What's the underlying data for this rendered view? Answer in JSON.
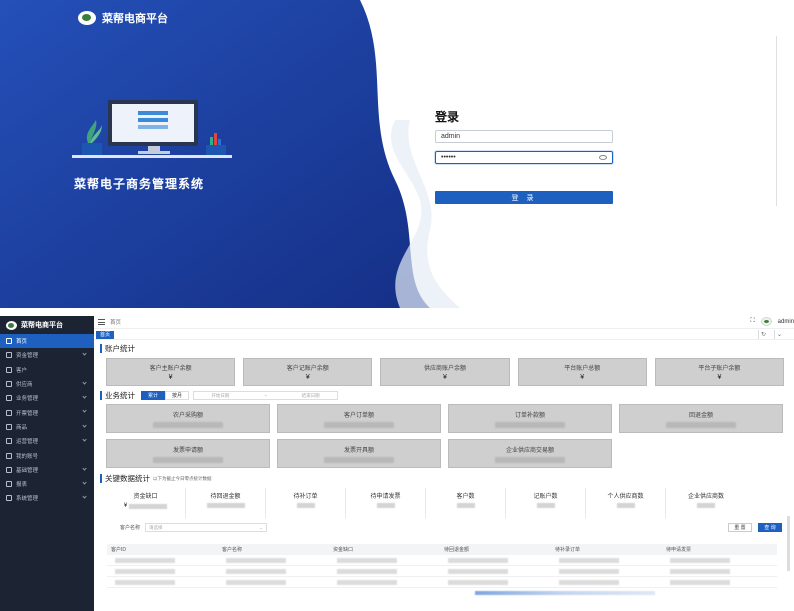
{
  "login": {
    "brand": "菜帮电商平台",
    "system_title": "菜帮电子商务管理系统",
    "form_title": "登录",
    "username_value": "admin",
    "password_value": "••••••",
    "submit_label": "登 录",
    "colors": {
      "primary": "#1e60c0",
      "bg_left": "#1a3f9f"
    }
  },
  "dashboard": {
    "sidebar": {
      "brand": "菜帮电商平台",
      "items": [
        {
          "label": "首页",
          "icon": "home-icon",
          "active": true,
          "chevron": false
        },
        {
          "label": "资金管理",
          "icon": "wallet-icon",
          "active": false,
          "chevron": true
        },
        {
          "label": "客户",
          "icon": "customer-icon",
          "active": false,
          "chevron": false
        },
        {
          "label": "供应商",
          "icon": "supplier-icon",
          "active": false,
          "chevron": true
        },
        {
          "label": "业务管理",
          "icon": "business-icon",
          "active": false,
          "chevron": true
        },
        {
          "label": "开票管理",
          "icon": "invoice-icon",
          "active": false,
          "chevron": true
        },
        {
          "label": "商品",
          "icon": "product-icon",
          "active": false,
          "chevron": true
        },
        {
          "label": "运营管理",
          "icon": "operation-icon",
          "active": false,
          "chevron": true
        },
        {
          "label": "我的账号",
          "icon": "account-icon",
          "active": false,
          "chevron": false
        },
        {
          "label": "基础管理",
          "icon": "settings-icon",
          "active": false,
          "chevron": true
        },
        {
          "label": "报表",
          "icon": "report-icon",
          "active": false,
          "chevron": true
        },
        {
          "label": "系统管理",
          "icon": "system-icon",
          "active": false,
          "chevron": true
        }
      ]
    },
    "topbar": {
      "breadcrumb": "首页",
      "username": "admin"
    },
    "tabs": {
      "home": "首页"
    },
    "account_stats": {
      "title": "账户统计",
      "cards": [
        {
          "label": "客户主账户余额",
          "value": "¥"
        },
        {
          "label": "客户记账户余额",
          "value": "¥"
        },
        {
          "label": "供应商账户余额",
          "value": "¥"
        },
        {
          "label": "平台账户总额",
          "value": "¥"
        },
        {
          "label": "平台子账户余额",
          "value": "¥"
        }
      ]
    },
    "business_stats": {
      "title": "业务统计",
      "segments": [
        "累计",
        "按月"
      ],
      "date_start_placeholder": "开始日期",
      "date_sep": "~",
      "date_end_placeholder": "结束日期",
      "cards": [
        {
          "label": "农户采购额"
        },
        {
          "label": "客户订单额"
        },
        {
          "label": "订单补款额"
        },
        {
          "label": "回退金额"
        },
        {
          "label": "发票申请额"
        },
        {
          "label": "发票开具额"
        },
        {
          "label": "企业供应商交易额"
        }
      ]
    },
    "key_stats": {
      "title": "关键数据统计",
      "note": "以下为截止今日零点统计数据",
      "items": [
        {
          "label": "资金缺口",
          "prefix": "¥"
        },
        {
          "label": "待回退金额",
          "prefix": ""
        },
        {
          "label": "待补订单",
          "prefix": ""
        },
        {
          "label": "待申请发票",
          "prefix": ""
        },
        {
          "label": "客户数",
          "prefix": ""
        },
        {
          "label": "记账户数",
          "prefix": ""
        },
        {
          "label": "个人供应商数",
          "prefix": ""
        },
        {
          "label": "企业供应商数",
          "prefix": ""
        }
      ]
    },
    "filter": {
      "label": "客户名称",
      "placeholder": "请选择",
      "reset_label": "重 置",
      "search_label": "查 询"
    },
    "table": {
      "columns": [
        "客户ID",
        "客户名称",
        "资金缺口",
        "待回退金额",
        "待补录订单",
        "待申请发票"
      ]
    }
  }
}
